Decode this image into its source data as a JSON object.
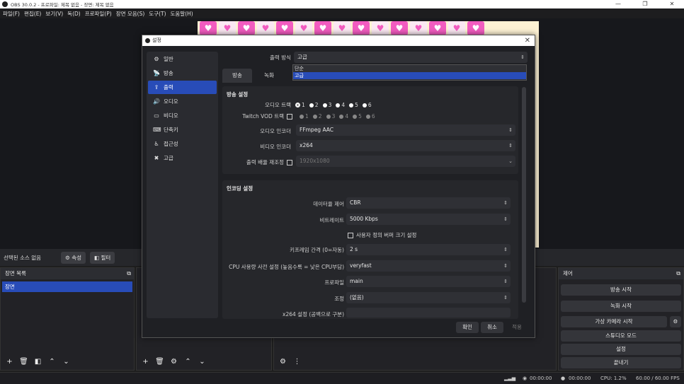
{
  "window": {
    "title": "OBS 30.0.2 - 프로파일: 제목 없음 - 장면: 제목 없음",
    "minimize": "—",
    "maximize": "❐",
    "close": "✕"
  },
  "menu": [
    "파일(F)",
    "편집(E)",
    "보기(V)",
    "독(D)",
    "프로파일(P)",
    "장면 모음(S)",
    "도구(T)",
    "도움말(H)"
  ],
  "source_bar": {
    "no_source": "선택된 소스 없음",
    "properties": "속성",
    "filters": "필터"
  },
  "scenes": {
    "title": "장면 목록",
    "items": [
      "장면"
    ]
  },
  "controls": {
    "title": "제어",
    "buttons": [
      "방송 시작",
      "녹화 시작",
      "가상 카메라 시작",
      "스튜디오 모드",
      "설정",
      "끝내기"
    ]
  },
  "status": {
    "stream_time": "00:00:00",
    "rec_time": "00:00:00",
    "cpu": "CPU: 1.2%",
    "fps": "60.00 / 60.00 FPS"
  },
  "settings": {
    "title": "설정",
    "nav": [
      {
        "icon": "⚙",
        "label": "일반"
      },
      {
        "icon": "📡",
        "label": "방송"
      },
      {
        "icon": "⇪",
        "label": "출력"
      },
      {
        "icon": "🔊",
        "label": "오디오"
      },
      {
        "icon": "▭",
        "label": "비디오"
      },
      {
        "icon": "⌨",
        "label": "단축키"
      },
      {
        "icon": "♿",
        "label": "접근성"
      },
      {
        "icon": "✖",
        "label": "고급"
      }
    ],
    "output_mode_label": "출력 방식",
    "output_mode_value": "고급",
    "output_mode_options": [
      "단순",
      "고급"
    ],
    "tabs": [
      "방송",
      "녹화"
    ],
    "stream_group": {
      "title": "방송 설정",
      "audio_track_label": "오디오 트랙",
      "vod_track_label": "Twitch VOD 트랙",
      "tracks": [
        "1",
        "2",
        "3",
        "4",
        "5",
        "6"
      ],
      "audio_encoder_label": "오디오 인코더",
      "audio_encoder_value": "FFmpeg AAC",
      "video_encoder_label": "비디오 인코더",
      "video_encoder_value": "x264",
      "rescale_label": "출력 배율 재조정",
      "rescale_value": "1920x1080"
    },
    "encoder_group": {
      "title": "인코딩 설정",
      "rate_control_label": "데이터율 제어",
      "rate_control_value": "CBR",
      "bitrate_label": "비트레이트",
      "bitrate_value": "5000 Kbps",
      "custom_buffer_label": "사용자 정의 버퍼 크기 설정",
      "keyframe_label": "키프레임 간격 (0=자동)",
      "keyframe_value": "2 s",
      "preset_label": "CPU 사용량 사전 설정 (높음수록 = 낮은 CPU부담)",
      "preset_value": "veryfast",
      "profile_label": "프로파일",
      "profile_value": "main",
      "tune_label": "조정",
      "tune_value": "(없음)",
      "x264_label": "x264 설정 (공백으로 구분)"
    },
    "buttons": {
      "ok": "확인",
      "cancel": "취소",
      "apply": "적용"
    }
  }
}
